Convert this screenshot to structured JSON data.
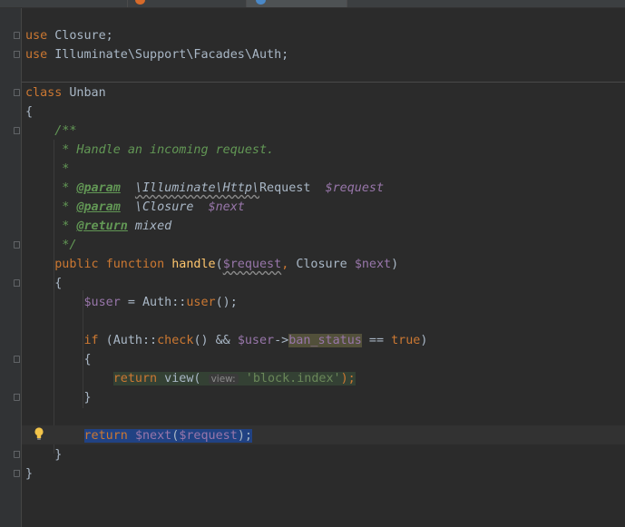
{
  "editor": {
    "tabs": [
      {
        "name": "tab-1",
        "active": false
      },
      {
        "name": "tab-2",
        "active": false
      },
      {
        "name": "tab-3",
        "active": true
      }
    ],
    "lines": {
      "use1_kw": "use",
      "use1_rest": " Closure;",
      "use2_kw": "use",
      "use2_rest": " Illuminate\\Support\\Facades\\Auth;",
      "class_kw": "class",
      "class_name": " Unban",
      "brace_open": "{",
      "doc_open": "    /**",
      "doc_line1": "     * Handle an incoming request.",
      "doc_star": "     *",
      "doc_param1_star": "     * ",
      "doc_param_tag": "@param",
      "doc_param1_type": "\\Illuminate\\Http\\",
      "doc_param1_type2": "Request",
      "doc_param1_var": "$request",
      "doc_param2_star": "     * ",
      "doc_param2_type": "\\Closure",
      "doc_param2_var": "$next",
      "doc_return_star": "     * ",
      "doc_return_tag": "@return",
      "doc_return_type": " mixed",
      "doc_close": "     */",
      "fn_public": "public",
      "fn_function": "function",
      "fn_name": "handle",
      "fn_arg1": "$request",
      "fn_arg2_type": "Closure ",
      "fn_arg2_var": "$next",
      "fn_brace_open": "    {",
      "user_var": "$user",
      "user_assign": " = Auth::",
      "user_call": "user",
      "user_end": "();",
      "if_kw": "if",
      "if_open": " (Auth::",
      "if_check": "check",
      "if_and": "() && ",
      "if_user": "$user",
      "if_arrow": "->",
      "if_field": "ban_status",
      "if_eq": " == ",
      "if_true": "true",
      "if_close": ")",
      "if_brace_open": "        {",
      "return1_kw": "return",
      "return1_fn": " view(",
      "return1_hint": "view:",
      "return1_str": "'block.index'",
      "return1_end": ");",
      "if_brace_close": "        }",
      "return2_kw": "return",
      "return2_var1": "$next",
      "return2_paren": "(",
      "return2_var2": "$request",
      "return2_end": ");",
      "fn_brace_close": "    }",
      "brace_close": "}"
    }
  }
}
